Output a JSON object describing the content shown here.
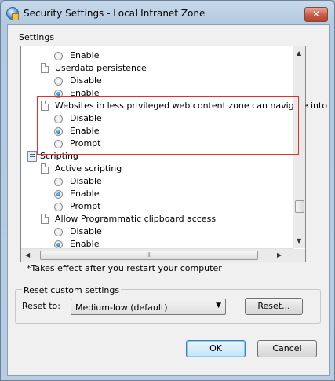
{
  "window": {
    "title": "Security Settings - Local Intranet Zone",
    "close": "✕"
  },
  "settings_label": "Settings",
  "list": {
    "items": [
      {
        "kind": "radio",
        "label": "Enable",
        "checked": false
      },
      {
        "kind": "setting",
        "label": "Userdata persistence"
      },
      {
        "kind": "radio",
        "label": "Disable",
        "checked": false
      },
      {
        "kind": "radio",
        "label": "Enable",
        "checked": true
      },
      {
        "kind": "setting",
        "label": "Websites in less privileged web content zone can navigate into"
      },
      {
        "kind": "radio",
        "label": "Disable",
        "checked": false
      },
      {
        "kind": "radio",
        "label": "Enable",
        "checked": true
      },
      {
        "kind": "radio",
        "label": "Prompt",
        "checked": false
      },
      {
        "kind": "category",
        "label": "Scripting"
      },
      {
        "kind": "setting",
        "label": "Active scripting"
      },
      {
        "kind": "radio",
        "label": "Disable",
        "checked": false
      },
      {
        "kind": "radio",
        "label": "Enable",
        "checked": true
      },
      {
        "kind": "radio",
        "label": "Prompt",
        "checked": false
      },
      {
        "kind": "setting",
        "label": "Allow Programmatic clipboard access"
      },
      {
        "kind": "radio",
        "label": "Disable",
        "checked": false
      },
      {
        "kind": "radio",
        "label": "Enable",
        "checked": true
      }
    ],
    "hscroll_grip": "III"
  },
  "note": "*Takes effect after you restart your computer",
  "reset": {
    "group_label": "Reset custom settings",
    "reset_to_label": "Reset to:",
    "selected": "Medium-low (default)",
    "reset_button": "Reset..."
  },
  "buttons": {
    "ok": "OK",
    "cancel": "Cancel"
  }
}
